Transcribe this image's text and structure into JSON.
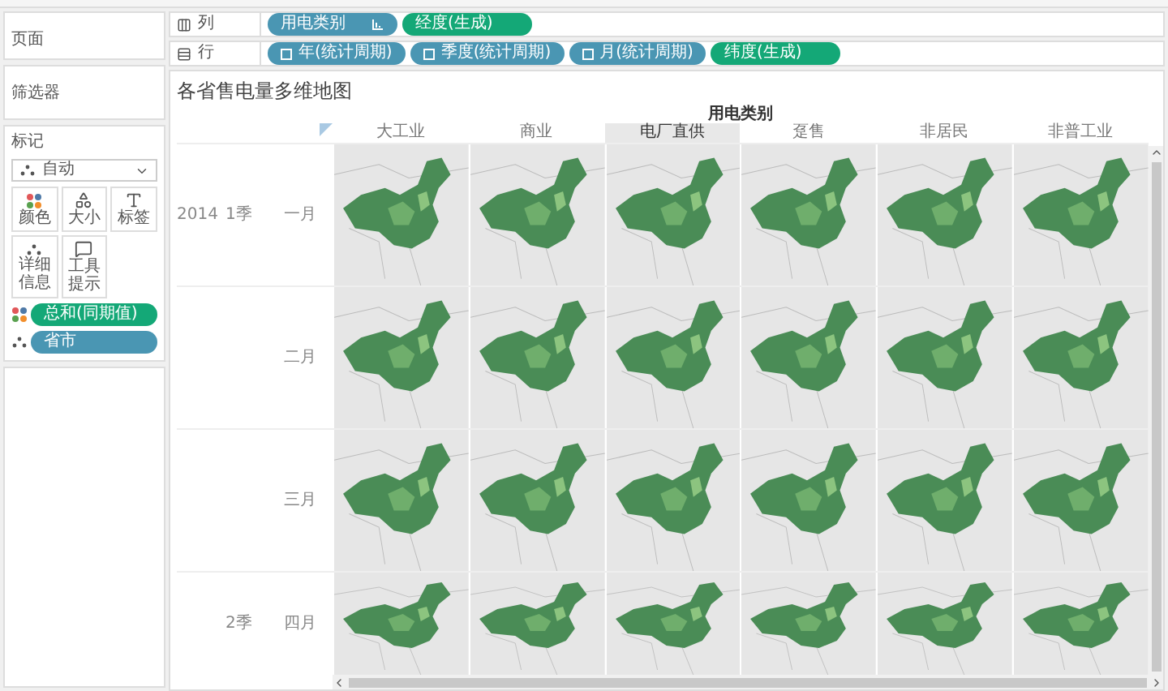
{
  "pages_card": {
    "title": "页面"
  },
  "filters_card": {
    "title": "筛选器"
  },
  "marks_card": {
    "title": "标记",
    "mark_type": "自动",
    "buttons": [
      {
        "label": "颜色",
        "kind": "color"
      },
      {
        "label": "大小",
        "kind": "size"
      },
      {
        "label": "标签",
        "kind": "label"
      },
      {
        "label": "详细信息",
        "kind": "detail"
      },
      {
        "label": "工具提示",
        "kind": "tooltip"
      }
    ],
    "fields": [
      {
        "label": "总和(同期值)",
        "kind": "color",
        "color": "#14a877"
      },
      {
        "label": "省市",
        "kind": "detail",
        "color": "#4a96b3"
      }
    ]
  },
  "columns_shelf": {
    "label": "列",
    "pills": [
      {
        "label": "用电类别",
        "kind": "dimension",
        "toggle": false,
        "sorted": true
      },
      {
        "label": "经度(生成)",
        "kind": "measure",
        "toggle": false,
        "sorted": false
      }
    ]
  },
  "rows_shelf": {
    "label": "行",
    "pills": [
      {
        "label": "年(统计周期)",
        "kind": "dimension",
        "toggle": true,
        "sorted": false
      },
      {
        "label": "季度(统计周期)",
        "kind": "dimension",
        "toggle": true,
        "sorted": false
      },
      {
        "label": "月(统计周期)",
        "kind": "dimension",
        "toggle": true,
        "sorted": false
      },
      {
        "label": "纬度(生成)",
        "kind": "measure",
        "toggle": false,
        "sorted": false
      }
    ]
  },
  "view": {
    "title": "各省售电量多维地图",
    "column_header": "用电类别",
    "columns": [
      {
        "label": "大工业",
        "highlighted": false
      },
      {
        "label": "商业",
        "highlighted": false
      },
      {
        "label": "电厂直供",
        "highlighted": true
      },
      {
        "label": "趸售",
        "highlighted": false
      },
      {
        "label": "非居民",
        "highlighted": false
      },
      {
        "label": "非普工业",
        "highlighted": false
      }
    ],
    "rows": [
      {
        "year": "2014",
        "quarter": "1季",
        "month": "一月"
      },
      {
        "month": "二月"
      },
      {
        "month": "三月"
      },
      {
        "quarter": "2季",
        "month": "四月"
      }
    ]
  }
}
